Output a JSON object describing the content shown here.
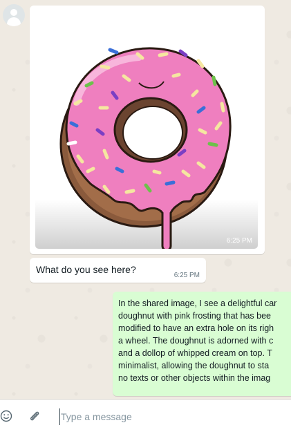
{
  "conversation": {
    "image_message": {
      "time": "6:25 PM"
    },
    "incoming_text": {
      "text": "What do you see here?",
      "time": "6:25 PM"
    },
    "outgoing_text": {
      "lines": [
        "In the shared image, I see a delightful car",
        "doughnut with pink frosting that has bee",
        "modified to have an extra hole on its righ",
        "a wheel. The doughnut is adorned with c",
        "and a dollop of whipped cream on top. T",
        "minimalist, allowing the doughnut to sta",
        "no texts or other objects within the imag"
      ]
    }
  },
  "composer": {
    "placeholder": "Type a message",
    "emoji_icon": "smiley-icon",
    "attach_icon": "paperclip-icon"
  },
  "colors": {
    "chat_background": "#efeae2",
    "incoming_bubble": "#ffffff",
    "outgoing_bubble": "#d9fdd3",
    "frosting": "#ef7fbf",
    "dough": "#8a5a3c"
  }
}
